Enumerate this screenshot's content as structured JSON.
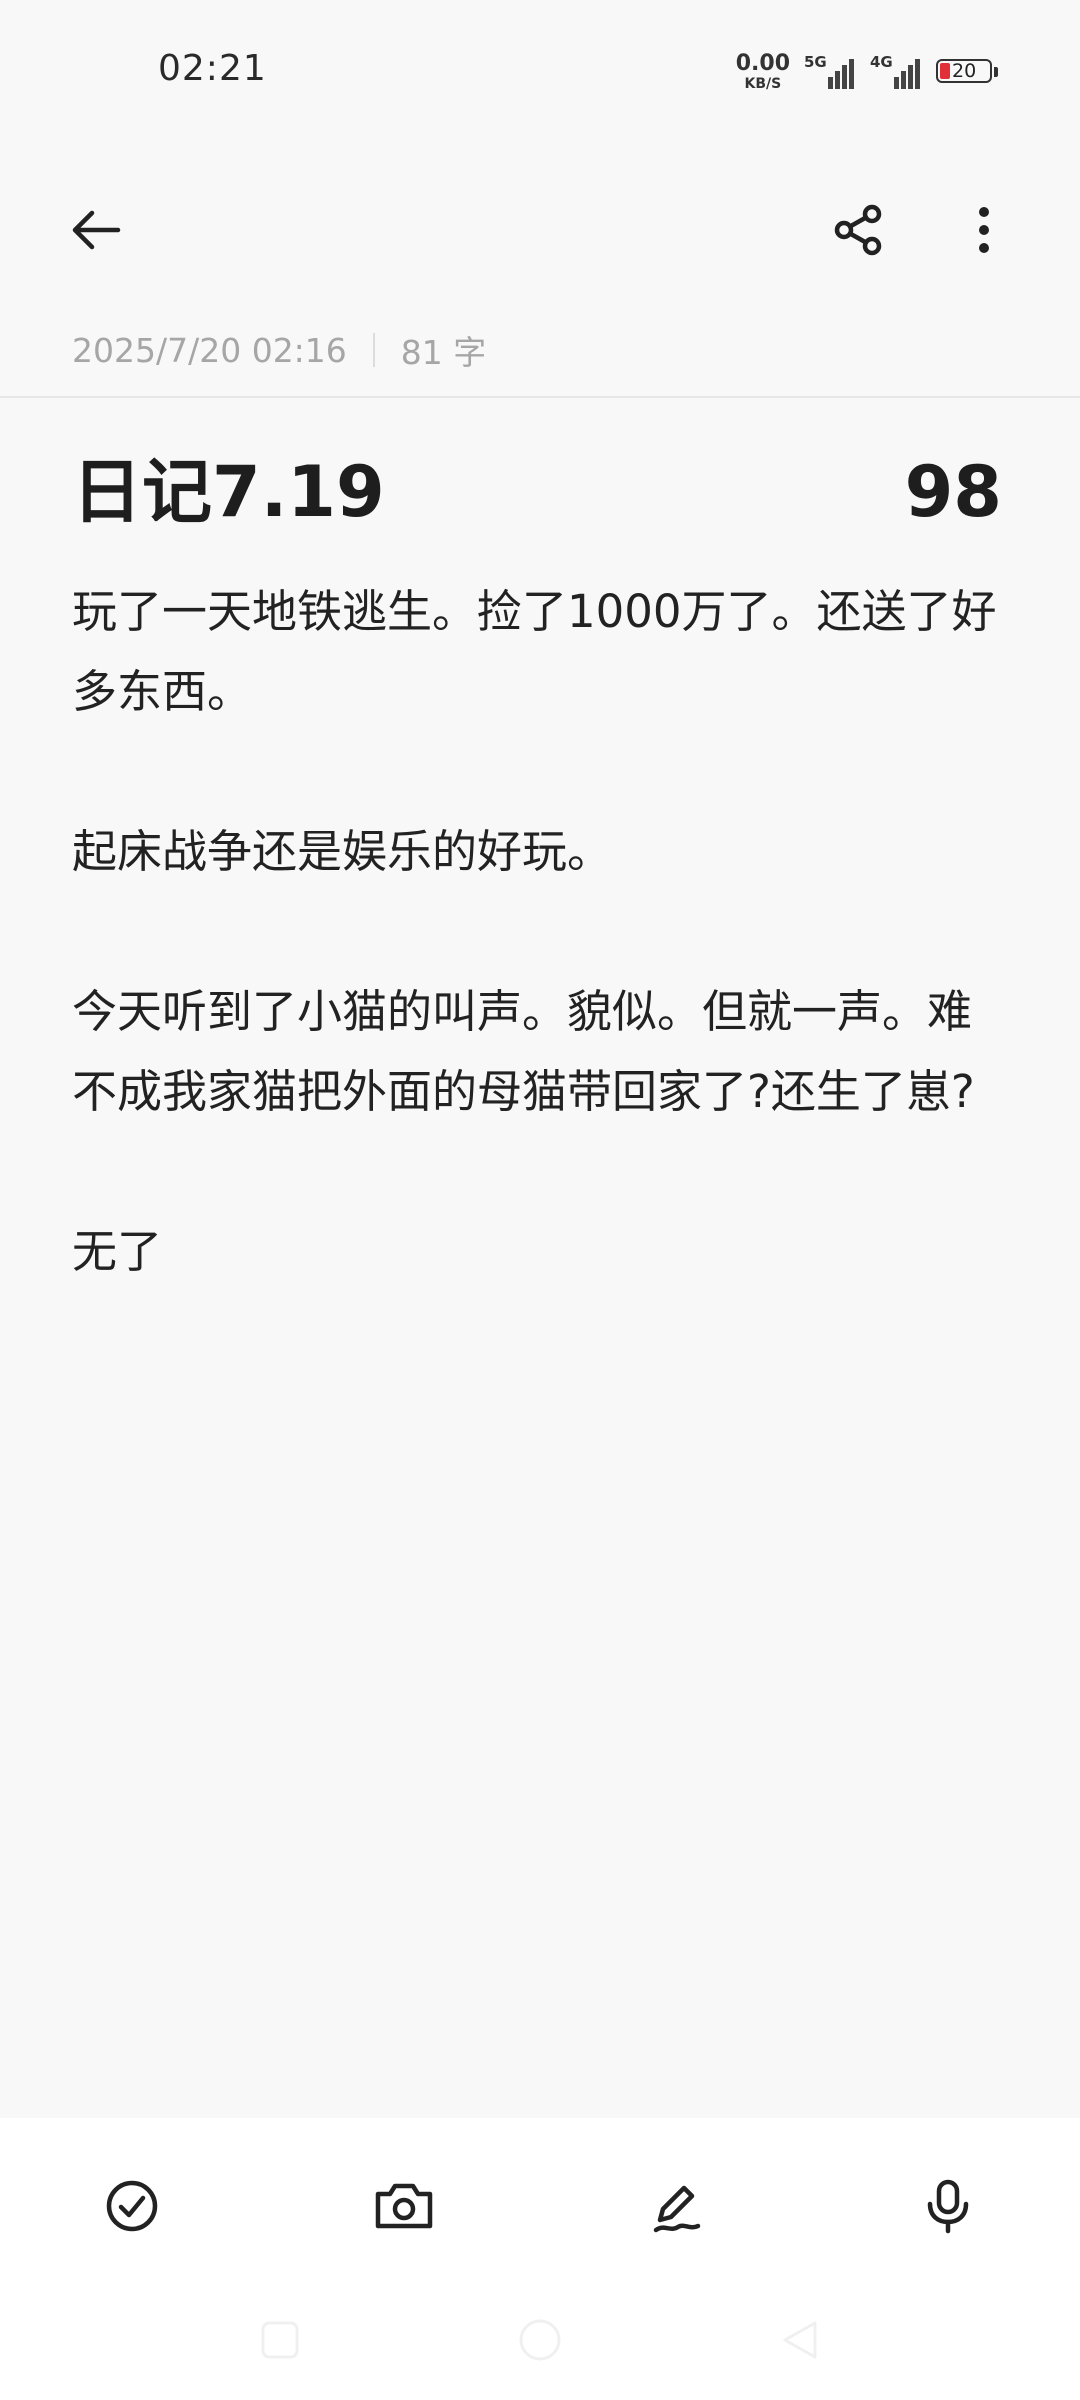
{
  "status_bar": {
    "time": "02:21",
    "net_speed_value": "0.00",
    "net_speed_unit": "KB/S",
    "signal_1_label": "5G",
    "signal_2_label": "4G",
    "battery_percent": "20"
  },
  "toolbar": {
    "back_icon": "arrow-left-icon",
    "share_icon": "share-icon",
    "more_icon": "more-vertical-icon"
  },
  "note": {
    "datetime": "2025/7/20 02:16",
    "char_count": "81 字",
    "title": "日记7.19",
    "badge": "98",
    "paragraphs": [
      "玩了一天地铁逃生。捡了1000万了。还送了好多东西。",
      "起床战争还是娱乐的好玩。",
      "今天听到了小猫的叫声。貌似。但就一声。难不成我家猫把外面的母猫带回家了?还生了崽?",
      "无了"
    ]
  },
  "bottom_bar": {
    "items": [
      "checklist-icon",
      "camera-icon",
      "handwriting-icon",
      "microphone-icon"
    ]
  },
  "colors": {
    "background": "#f8f8f9",
    "text": "#1e1e1e",
    "meta_text": "#a6a6a6",
    "battery_low": "#e2303a"
  }
}
